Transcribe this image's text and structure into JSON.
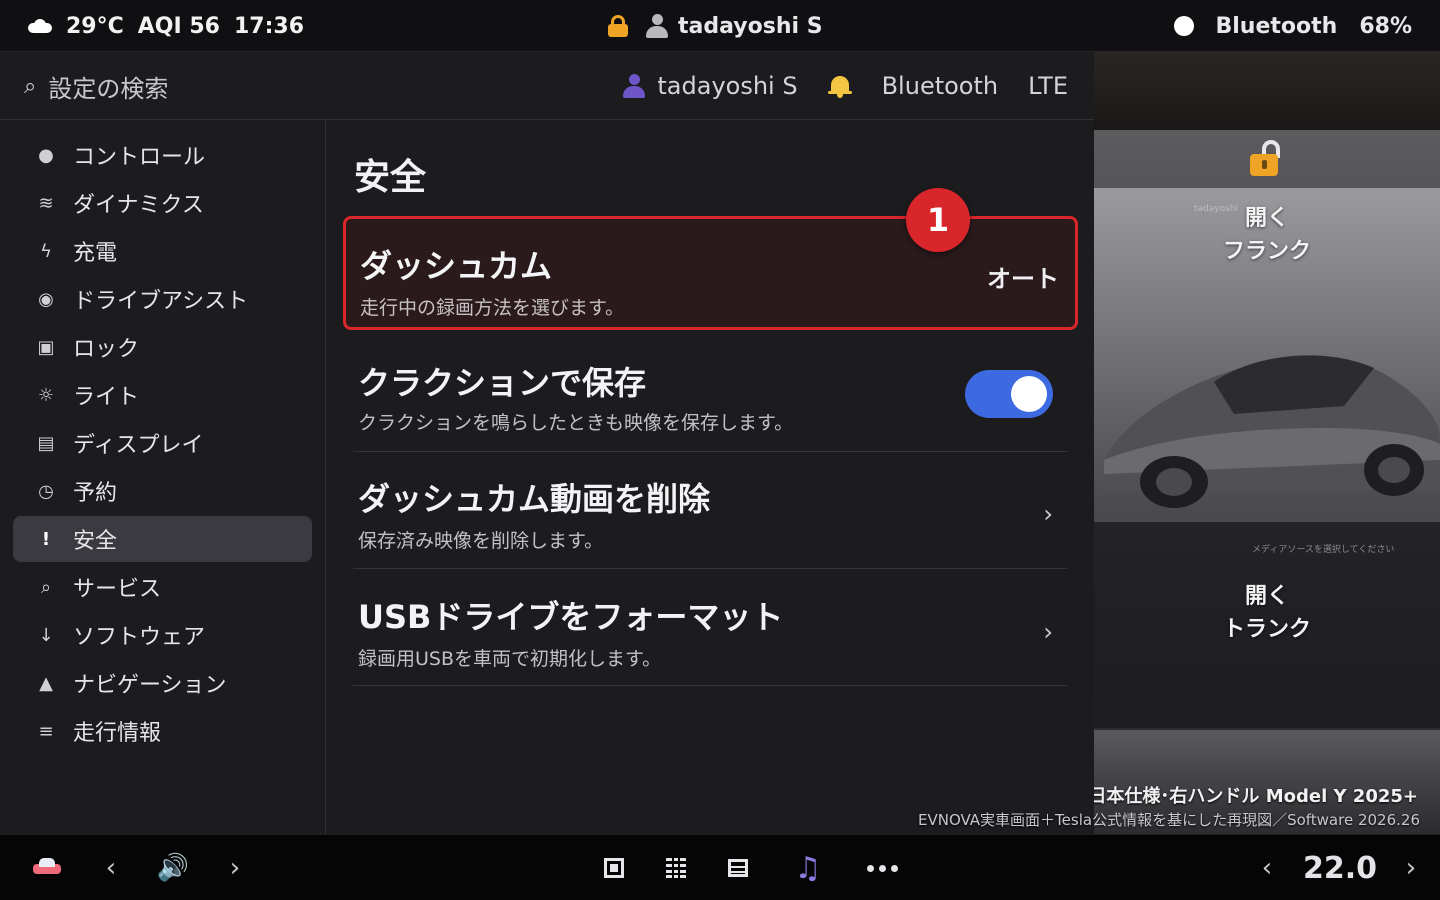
{
  "status_bar": {
    "temperature": "29°C",
    "aqi": "AQI 56",
    "time": "17:36",
    "user": "tadayoshi S",
    "bluetooth": "Bluetooth",
    "battery": "68%"
  },
  "header": {
    "search_placeholder": "設定の検索",
    "user": "tadayoshi S",
    "bluetooth": "Bluetooth",
    "network": "LTE"
  },
  "sidebar": {
    "items": [
      {
        "label": "コントロール",
        "icon": "●",
        "icon_name": "controls-icon"
      },
      {
        "label": "ダイナミクス",
        "icon": "≋",
        "icon_name": "dynamics-icon"
      },
      {
        "label": "充電",
        "icon": "ϟ",
        "icon_name": "charge-icon"
      },
      {
        "label": "ドライブアシスト",
        "icon": "◉",
        "icon_name": "drive-assist-icon"
      },
      {
        "label": "ロック",
        "icon": "▣",
        "icon_name": "lock-icon"
      },
      {
        "label": "ライト",
        "icon": "☼",
        "icon_name": "light-icon"
      },
      {
        "label": "ディスプレイ",
        "icon": "▤",
        "icon_name": "display-icon"
      },
      {
        "label": "予約",
        "icon": "◷",
        "icon_name": "schedule-icon"
      },
      {
        "label": "安全",
        "icon": "!",
        "icon_name": "safety-icon"
      },
      {
        "label": "サービス",
        "icon": "⌕",
        "icon_name": "service-icon"
      },
      {
        "label": "ソフトウェア",
        "icon": "↓",
        "icon_name": "software-icon"
      },
      {
        "label": "ナビゲーション",
        "icon": "▲",
        "icon_name": "navigation-icon"
      },
      {
        "label": "走行情報",
        "icon": "≡",
        "icon_name": "trip-icon"
      }
    ],
    "active_index": 8
  },
  "content": {
    "title": "安全",
    "rows": [
      {
        "title": "ダッシュカム",
        "subtitle": "走行中の録画方法を選びます。",
        "value": "オート",
        "badge": "1"
      },
      {
        "title": "クラクションで保存",
        "subtitle": "クラクションを鳴らしたときも映像を保存します。",
        "toggle_on": true
      },
      {
        "title": "ダッシュカム動画を削除",
        "subtitle": "保存済み映像を削除します。",
        "chevron": "›"
      },
      {
        "title": "USBドライブをフォーマット",
        "subtitle": "録画用USBを車両で初期化します。",
        "chevron": "›"
      }
    ]
  },
  "car_panel": {
    "frunk_action": "開く",
    "frunk_label": "フランク",
    "trunk_action": "開く",
    "trunk_label": "トランク",
    "footer_model": "日本仕様･右ハンドル Model Y 2025+",
    "footer_note": "EVNOVA実車画面＋Tesla公式情報を基にした再現図／Software 2026.26"
  },
  "bottom_bar": {
    "temperature": "22.0",
    "left_arrow": "‹",
    "right_arrow": "›"
  },
  "colors": {
    "accent_red": "#d9262b",
    "toggle_blue": "#3e6ae1",
    "lock_orange": "#f0a426",
    "music_purple": "#8f7ae0",
    "user_purple": "#6f56c8",
    "bell_yellow": "#f4c542"
  }
}
